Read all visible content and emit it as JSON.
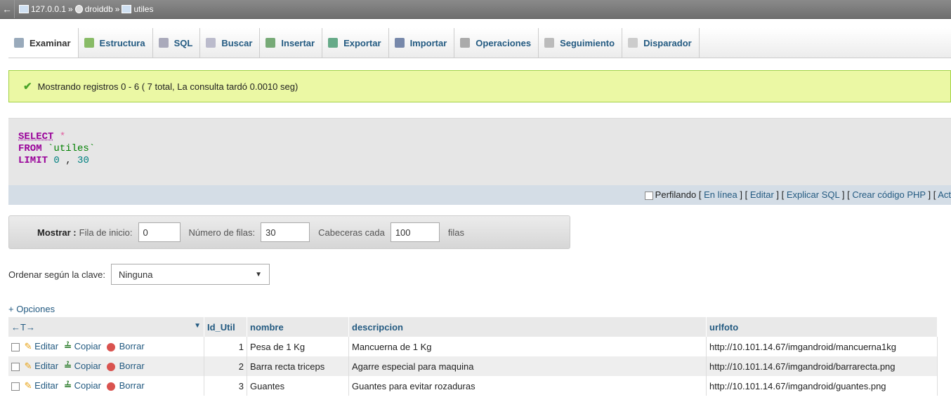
{
  "breadcrumb": {
    "server": "127.0.0.1",
    "sep1": "»",
    "db": "droiddb",
    "sep2": "»",
    "table": "utiles"
  },
  "tabs": [
    {
      "label": "Examinar",
      "icon": "browse-icon",
      "color": "#9ab"
    },
    {
      "label": "Estructura",
      "icon": "structure-icon",
      "color": "#8b6"
    },
    {
      "label": "SQL",
      "icon": "sql-icon",
      "color": "#aab"
    },
    {
      "label": "Buscar",
      "icon": "search-icon",
      "color": "#bbc"
    },
    {
      "label": "Insertar",
      "icon": "insert-icon",
      "color": "#7a7"
    },
    {
      "label": "Exportar",
      "icon": "export-icon",
      "color": "#6a8"
    },
    {
      "label": "Importar",
      "icon": "import-icon",
      "color": "#78a"
    },
    {
      "label": "Operaciones",
      "icon": "wrench-icon",
      "color": "#aaa"
    },
    {
      "label": "Seguimiento",
      "icon": "eye-icon",
      "color": "#bbb"
    },
    {
      "label": "Disparador",
      "icon": "trigger-icon",
      "color": "#ccc"
    }
  ],
  "success": {
    "message": "Mostrando registros 0 - 6 ( 7 total, La consulta tardó 0.0010 seg)"
  },
  "sql": {
    "select": "SELECT",
    "star": "*",
    "from": "FROM",
    "table": "`utiles`",
    "limit": "LIMIT",
    "lim_a": "0",
    "comma": ",",
    "lim_b": "30"
  },
  "sqlfoot": {
    "profiling": "Perfilando",
    "links": [
      "En línea",
      "Editar",
      "Explicar SQL",
      "Crear código PHP",
      "Act"
    ]
  },
  "nav": {
    "mostrar": "Mostrar :",
    "fila_label": "Fila de inicio:",
    "fila_val": "0",
    "num_label": "Número de filas:",
    "num_val": "30",
    "cab_label": "Cabeceras cada",
    "cab_val": "100",
    "filas": "filas"
  },
  "sort": {
    "label": "Ordenar según la clave:",
    "value": "Ninguna"
  },
  "opciones": "+ Opciones",
  "table": {
    "arrows": "←T→",
    "headers": [
      "Id_Util",
      "nombre",
      "descripcion",
      "urlfoto"
    ],
    "actions": {
      "edit": "Editar",
      "copy": "Copiar",
      "delete": "Borrar"
    },
    "rows": [
      {
        "id": "1",
        "nombre": "Pesa de 1 Kg",
        "descripcion": "Mancuerna de 1 Kg",
        "urlfoto": "http://10.101.14.67/imgandroid/mancuerna1kg"
      },
      {
        "id": "2",
        "nombre": "Barra recta triceps",
        "descripcion": "Agarre especial para maquina",
        "urlfoto": "http://10.101.14.67/imgandroid/barrarecta.png"
      },
      {
        "id": "3",
        "nombre": "Guantes",
        "descripcion": "Guantes para evitar rozaduras",
        "urlfoto": "http://10.101.14.67/imgandroid/guantes.png"
      }
    ]
  }
}
